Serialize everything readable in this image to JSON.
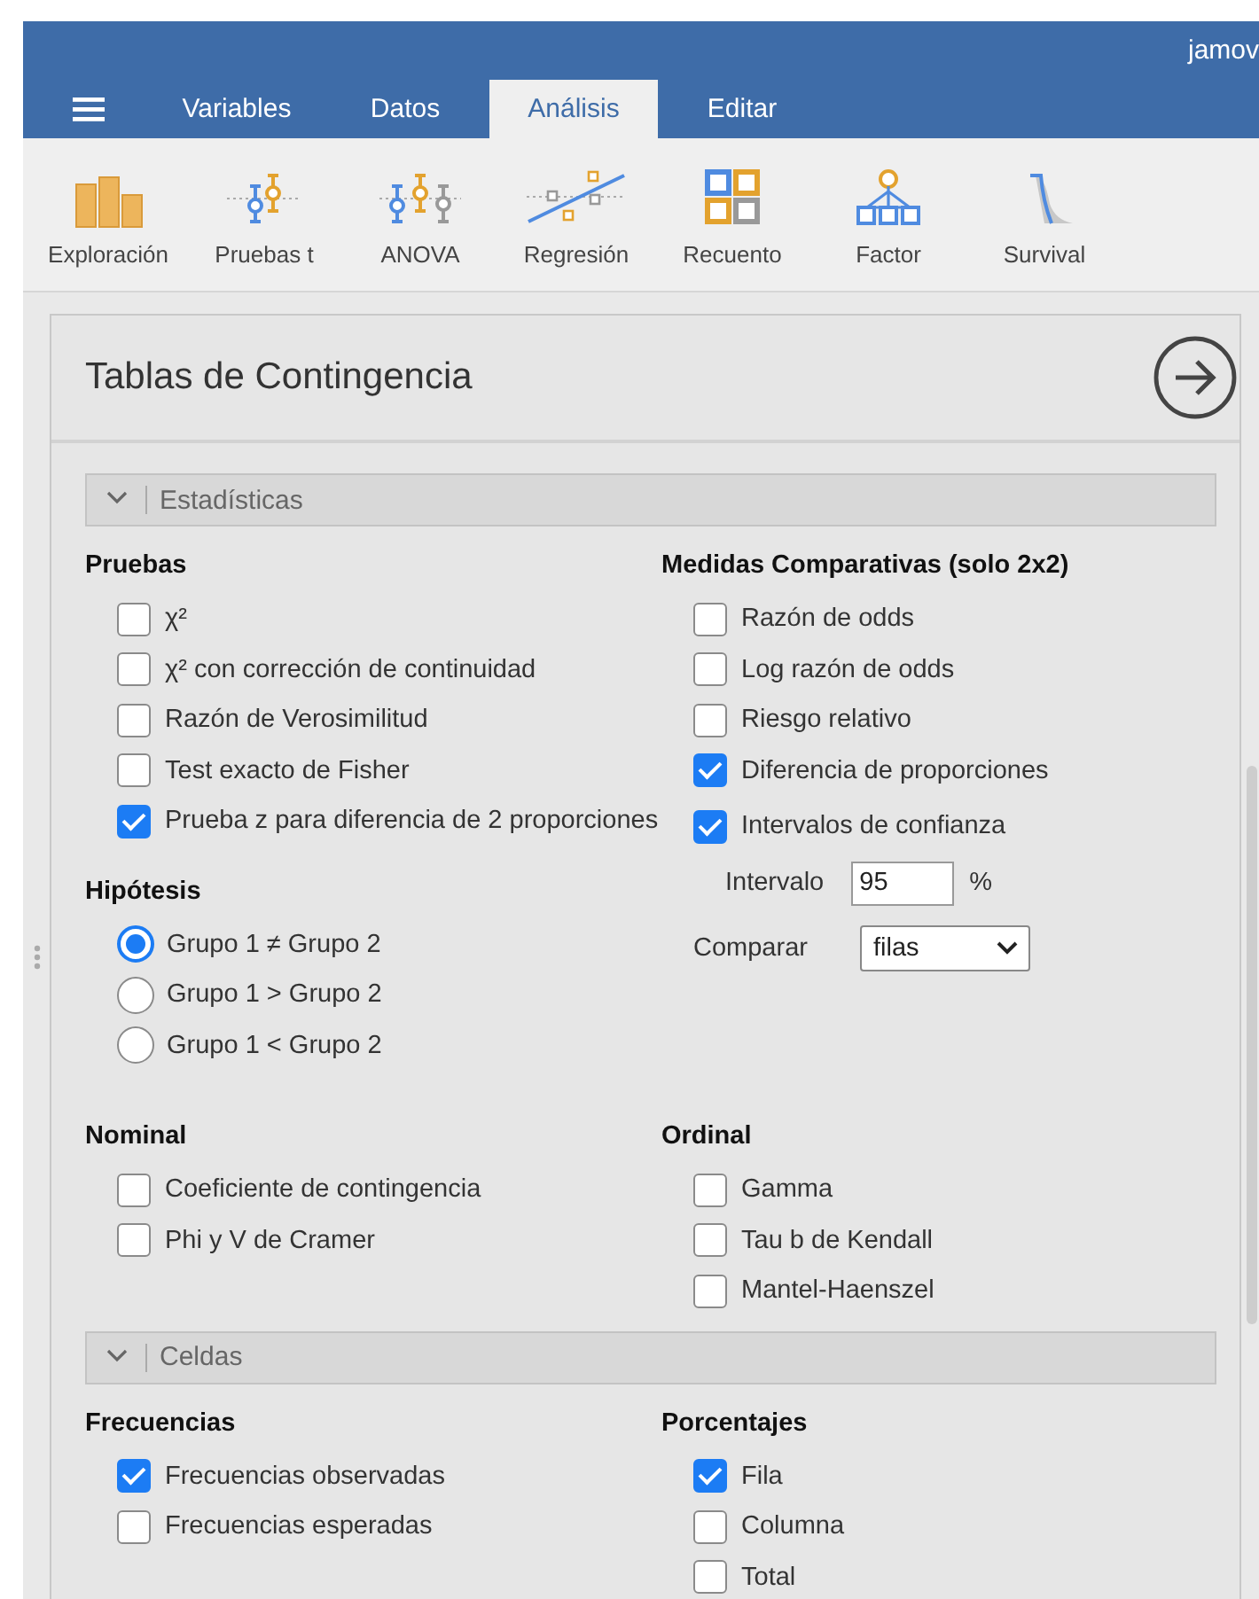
{
  "window": {
    "title": "jamov"
  },
  "tabs": [
    {
      "label": "Variables",
      "selected": false
    },
    {
      "label": "Datos",
      "selected": false
    },
    {
      "label": "Análisis",
      "selected": true
    },
    {
      "label": "Editar",
      "selected": false
    }
  ],
  "toolbar": [
    "Exploración",
    "Pruebas t",
    "ANOVA",
    "Regresión",
    "Recuento",
    "Factor",
    "Survival"
  ],
  "analysis": {
    "title": "Tablas de Contingencia",
    "sections": [
      {
        "title": "Estadísticas",
        "expanded": true,
        "blocks": [
          {
            "columns": [
              [
                {
                  "heading": "Pruebas",
                  "items": [
                    {
                      "kind": "checkbox",
                      "label": "χ²",
                      "checked": false
                    },
                    {
                      "kind": "checkbox",
                      "label": "χ² con corrección de continuidad",
                      "checked": false
                    },
                    {
                      "kind": "checkbox",
                      "label": "Razón de Verosimilitud",
                      "checked": false
                    },
                    {
                      "kind": "checkbox",
                      "label": "Test exacto de Fisher",
                      "checked": false
                    },
                    {
                      "kind": "checkbox",
                      "label": "Prueba z para diferencia de 2 proporciones",
                      "checked": true
                    }
                  ]
                },
                {
                  "heading": "Hipótesis",
                  "items": [
                    {
                      "kind": "radio",
                      "label": "Grupo 1 ≠ Grupo 2",
                      "selected": true
                    },
                    {
                      "kind": "radio",
                      "label": "Grupo 1 > Grupo 2",
                      "selected": false
                    },
                    {
                      "kind": "radio",
                      "label": "Grupo 1 < Grupo 2",
                      "selected": false
                    }
                  ]
                }
              ],
              [
                {
                  "heading": "Medidas Comparativas (solo 2x2)",
                  "items": [
                    {
                      "kind": "checkbox",
                      "label": "Razón de odds",
                      "checked": false
                    },
                    {
                      "kind": "checkbox",
                      "label": "Log razón de odds",
                      "checked": false
                    },
                    {
                      "kind": "checkbox",
                      "label": "Riesgo relativo",
                      "checked": false
                    },
                    {
                      "kind": "checkbox",
                      "label": "Diferencia de proporciones",
                      "checked": true
                    },
                    {
                      "kind": "checkbox",
                      "label": "Intervalos de confianza",
                      "checked": true
                    },
                    {
                      "kind": "number",
                      "label": "Intervalo",
                      "value": "95",
                      "unit": "%"
                    },
                    {
                      "kind": "select",
                      "label": "Comparar",
                      "value": "filas"
                    }
                  ]
                }
              ]
            ]
          },
          {
            "columns": [
              [
                {
                  "heading": "Nominal",
                  "items": [
                    {
                      "kind": "checkbox",
                      "label": "Coeficiente de contingencia",
                      "checked": false
                    },
                    {
                      "kind": "checkbox",
                      "label": "Phi y V de Cramer",
                      "checked": false
                    }
                  ]
                }
              ],
              [
                {
                  "heading": "Ordinal",
                  "items": [
                    {
                      "kind": "checkbox",
                      "label": "Gamma",
                      "checked": false
                    },
                    {
                      "kind": "checkbox",
                      "label": "Tau b de Kendall",
                      "checked": false
                    },
                    {
                      "kind": "checkbox",
                      "label": "Mantel-Haenszel",
                      "checked": false
                    }
                  ]
                }
              ]
            ]
          }
        ]
      },
      {
        "title": "Celdas",
        "expanded": true,
        "blocks": [
          {
            "columns": [
              [
                {
                  "heading": "Frecuencias",
                  "items": [
                    {
                      "kind": "checkbox",
                      "label": "Frecuencias observadas",
                      "checked": true
                    },
                    {
                      "kind": "checkbox",
                      "label": "Frecuencias esperadas",
                      "checked": false
                    }
                  ]
                }
              ],
              [
                {
                  "heading": "Porcentajes",
                  "items": [
                    {
                      "kind": "checkbox",
                      "label": "Fila",
                      "checked": true
                    },
                    {
                      "kind": "checkbox",
                      "label": "Columna",
                      "checked": false
                    },
                    {
                      "kind": "checkbox",
                      "label": "Total",
                      "checked": false
                    }
                  ]
                }
              ]
            ]
          }
        ]
      }
    ]
  }
}
